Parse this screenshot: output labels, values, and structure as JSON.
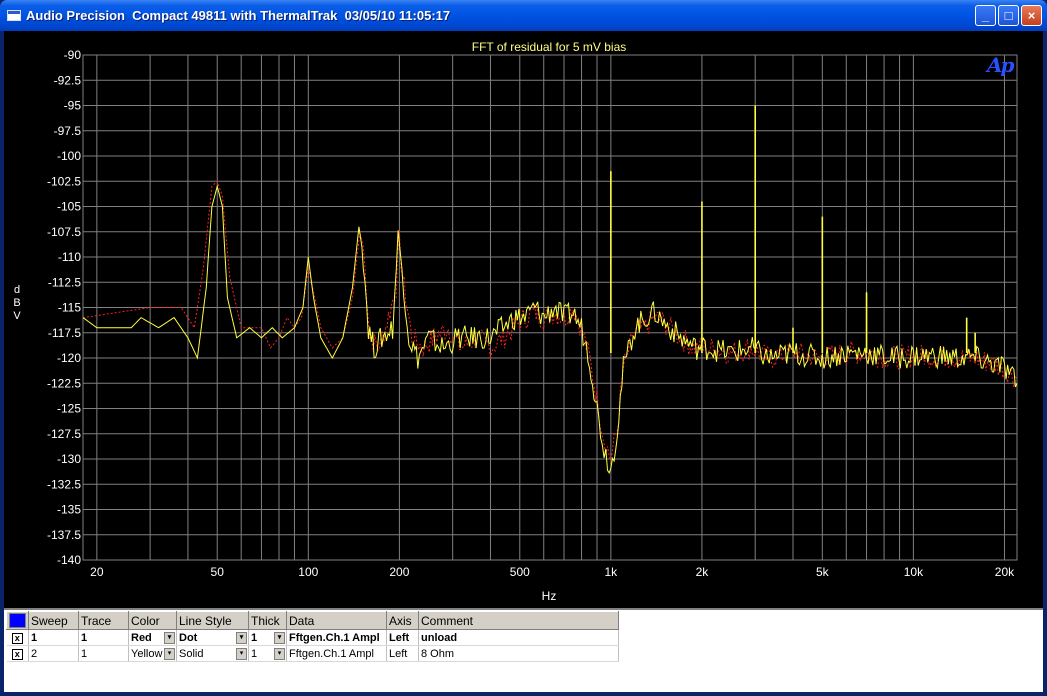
{
  "window": {
    "title": "Audio Precision  Compact 49811 with ThermalTrak  03/05/10 11:05:17",
    "min_label": "_",
    "max_label": "□",
    "close_label": "×"
  },
  "logo": {
    "text": "Ap",
    "color": "#2a50ff"
  },
  "chart_data": {
    "type": "line",
    "title": "FFT of residual for 5 mV bias",
    "xlabel": "Hz",
    "ylabel": "d B V",
    "x_scale": "log",
    "xlim": [
      18,
      22000
    ],
    "ylim": [
      -140,
      -90
    ],
    "grid": true,
    "x_tick_labels": [
      {
        "value": 20,
        "label": "20"
      },
      {
        "value": 50,
        "label": "50"
      },
      {
        "value": 100,
        "label": "100"
      },
      {
        "value": 200,
        "label": "200"
      },
      {
        "value": 500,
        "label": "500"
      },
      {
        "value": 1000,
        "label": "1k"
      },
      {
        "value": 2000,
        "label": "2k"
      },
      {
        "value": 5000,
        "label": "5k"
      },
      {
        "value": 10000,
        "label": "10k"
      },
      {
        "value": 20000,
        "label": "20k"
      }
    ],
    "y_ticks": [
      -90,
      -92.5,
      -95,
      -97.5,
      -100,
      -102.5,
      -105,
      -107.5,
      -110,
      -112.5,
      -115,
      -117.5,
      -120,
      -122.5,
      -125,
      -127.5,
      -130,
      -132.5,
      -135,
      -137.5,
      -140
    ],
    "colors": {
      "background": "#000000",
      "grid": "#808080",
      "text": "#ffffff",
      "title": "#ffff80"
    },
    "series": [
      {
        "name": "unload",
        "color": "#ff2020",
        "style": "dot",
        "points": [
          [
            18,
            -116
          ],
          [
            30,
            -115
          ],
          [
            38,
            -115
          ],
          [
            42,
            -117
          ],
          [
            45,
            -111
          ],
          [
            48,
            -103
          ],
          [
            50,
            -102.5
          ],
          [
            52,
            -104
          ],
          [
            55,
            -112
          ],
          [
            60,
            -117
          ],
          [
            65,
            -117
          ],
          [
            70,
            -117
          ],
          [
            75,
            -119
          ],
          [
            80,
            -118
          ],
          [
            85,
            -116
          ],
          [
            90,
            -117
          ],
          [
            95,
            -116
          ],
          [
            100,
            -111
          ],
          [
            105,
            -114
          ],
          [
            110,
            -117
          ],
          [
            120,
            -119
          ],
          [
            130,
            -118
          ],
          [
            140,
            -114
          ],
          [
            148,
            -107.5
          ],
          [
            152,
            -109
          ],
          [
            160,
            -118
          ],
          [
            170,
            -119
          ],
          [
            180,
            -117
          ],
          [
            195,
            -113
          ],
          [
            200,
            -108.5
          ],
          [
            205,
            -112
          ],
          [
            220,
            -118
          ],
          [
            240,
            -119
          ],
          [
            260,
            -118
          ],
          [
            290,
            -117
          ],
          [
            320,
            -119
          ],
          [
            360,
            -118
          ],
          [
            400,
            -119
          ],
          [
            440,
            -118
          ],
          [
            480,
            -117
          ],
          [
            520,
            -116
          ],
          [
            560,
            -115.5
          ],
          [
            600,
            -116
          ],
          [
            650,
            -115.5
          ],
          [
            700,
            -116
          ],
          [
            750,
            -115
          ],
          [
            800,
            -117
          ],
          [
            850,
            -120
          ],
          [
            900,
            -124
          ],
          [
            950,
            -128
          ],
          [
            1000,
            -130
          ],
          [
            1050,
            -127
          ],
          [
            1100,
            -121
          ],
          [
            1200,
            -117.5
          ],
          [
            1300,
            -117
          ],
          [
            1400,
            -116
          ],
          [
            1500,
            -116.5
          ],
          [
            1700,
            -118
          ],
          [
            1900,
            -119
          ],
          [
            2100,
            -119
          ],
          [
            2500,
            -119.5
          ],
          [
            2900,
            -119
          ],
          [
            3300,
            -120
          ],
          [
            4000,
            -119.5
          ],
          [
            5000,
            -120
          ],
          [
            6000,
            -119.5
          ],
          [
            7000,
            -119.5
          ],
          [
            8500,
            -120
          ],
          [
            10000,
            -119.8
          ],
          [
            12000,
            -119.8
          ],
          [
            14000,
            -120
          ],
          [
            16000,
            -120
          ],
          [
            18000,
            -120.5
          ],
          [
            20000,
            -121
          ],
          [
            22000,
            -122
          ]
        ]
      },
      {
        "name": "8 Ohm",
        "color": "#ffff40",
        "style": "solid",
        "points": [
          [
            18,
            -116
          ],
          [
            20,
            -117
          ],
          [
            26,
            -117
          ],
          [
            28,
            -116
          ],
          [
            32,
            -117
          ],
          [
            36,
            -116
          ],
          [
            40,
            -118
          ],
          [
            43,
            -120
          ],
          [
            46,
            -113
          ],
          [
            48,
            -105
          ],
          [
            50,
            -103
          ],
          [
            52,
            -105
          ],
          [
            54,
            -114
          ],
          [
            58,
            -118
          ],
          [
            64,
            -117
          ],
          [
            70,
            -118
          ],
          [
            76,
            -117
          ],
          [
            82,
            -118
          ],
          [
            90,
            -117
          ],
          [
            96,
            -115
          ],
          [
            100,
            -110
          ],
          [
            104,
            -114
          ],
          [
            110,
            -118
          ],
          [
            120,
            -120
          ],
          [
            130,
            -118
          ],
          [
            140,
            -113
          ],
          [
            147,
            -107
          ],
          [
            152,
            -110
          ],
          [
            158,
            -117
          ],
          [
            165,
            -119
          ],
          [
            175,
            -118
          ],
          [
            190,
            -117
          ],
          [
            198,
            -108
          ],
          [
            204,
            -111
          ],
          [
            215,
            -118
          ],
          [
            230,
            -120
          ],
          [
            250,
            -118
          ],
          [
            280,
            -119
          ],
          [
            310,
            -118
          ],
          [
            350,
            -118
          ],
          [
            400,
            -118
          ],
          [
            440,
            -117
          ],
          [
            480,
            -116
          ],
          [
            520,
            -116
          ],
          [
            560,
            -115
          ],
          [
            600,
            -116
          ],
          [
            650,
            -115
          ],
          [
            700,
            -116
          ],
          [
            750,
            -115.5
          ],
          [
            800,
            -117
          ],
          [
            850,
            -120
          ],
          [
            900,
            -125
          ],
          [
            950,
            -129
          ],
          [
            1000,
            -131
          ],
          [
            1050,
            -127
          ],
          [
            1100,
            -121
          ],
          [
            1200,
            -117
          ],
          [
            1300,
            -116
          ],
          [
            1400,
            -115.5
          ],
          [
            1500,
            -116.5
          ],
          [
            1700,
            -118
          ],
          [
            1900,
            -119
          ],
          [
            2100,
            -119
          ],
          [
            2500,
            -119.5
          ],
          [
            2900,
            -119
          ],
          [
            3300,
            -120
          ],
          [
            4000,
            -119.5
          ],
          [
            5000,
            -120
          ],
          [
            6000,
            -119.5
          ],
          [
            7000,
            -119.5
          ],
          [
            8500,
            -120
          ],
          [
            10000,
            -119.8
          ],
          [
            12000,
            -119.8
          ],
          [
            14000,
            -120
          ],
          [
            16000,
            -120
          ],
          [
            18000,
            -120.5
          ],
          [
            20000,
            -121
          ],
          [
            22000,
            -122.5
          ]
        ],
        "spikes": [
          [
            1000,
            -101.5
          ],
          [
            2000,
            -104.5
          ],
          [
            3000,
            -95
          ],
          [
            4000,
            -117
          ],
          [
            5000,
            -106
          ],
          [
            7000,
            -113.5
          ],
          [
            15000,
            -116
          ],
          [
            16000,
            -117.5
          ]
        ]
      }
    ]
  },
  "legend": {
    "headers": [
      "Sweep",
      "Trace",
      "Color",
      "Line Style",
      "Thick",
      "Data",
      "Axis",
      "Comment"
    ],
    "rows": [
      {
        "checked": "x",
        "sweep": "1",
        "trace": "1",
        "color": "Red",
        "line_style": "Dot",
        "thick": "1",
        "data": "Fftgen.Ch.1 Ampl",
        "axis": "Left",
        "comment": "unload"
      },
      {
        "checked": "x",
        "sweep": "2",
        "trace": "1",
        "color": "Yellow",
        "line_style": "Solid",
        "thick": "1",
        "data": "Fftgen.Ch.1 Ampl",
        "axis": "Left",
        "comment": "8 Ohm"
      }
    ],
    "dropdown_glyph": "▾"
  }
}
